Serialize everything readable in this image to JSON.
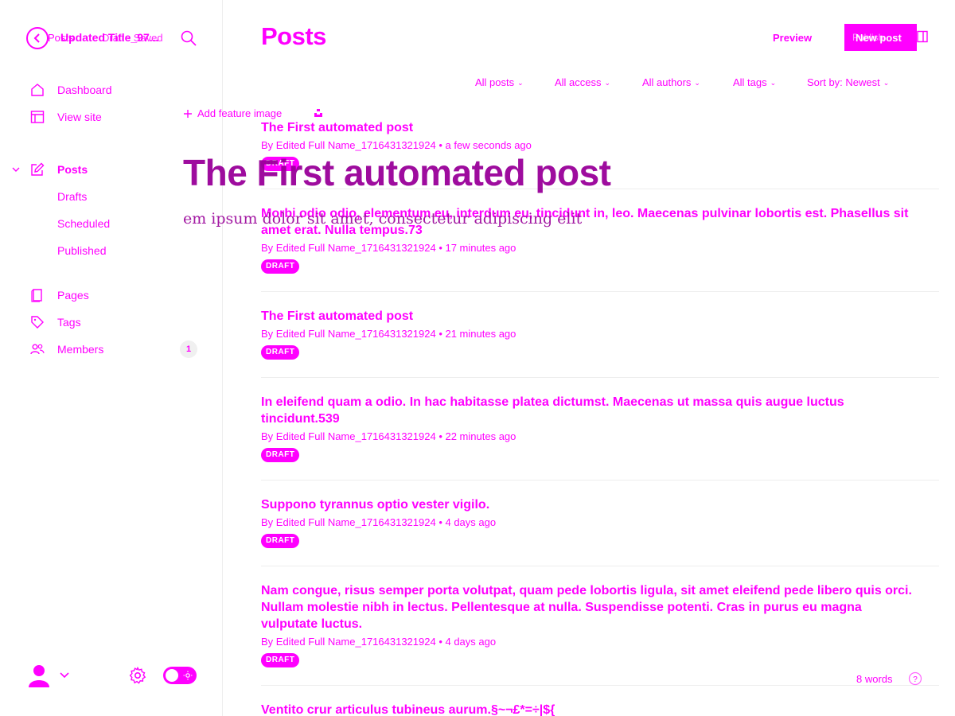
{
  "sidebar": {
    "nav": [
      {
        "label": "Dashboard"
      },
      {
        "label": "View site"
      },
      {
        "label": "Posts"
      },
      {
        "label": "Drafts"
      },
      {
        "label": "Scheduled"
      },
      {
        "label": "Published"
      },
      {
        "label": "Pages"
      },
      {
        "label": "Tags"
      },
      {
        "label": "Members",
        "badge": "1"
      }
    ]
  },
  "header": {
    "title": "Posts",
    "preview_label": "Preview",
    "new_post_label": "New post",
    "publish_label": "Publish"
  },
  "filters": [
    {
      "label": "All posts"
    },
    {
      "label": "All access"
    },
    {
      "label": "All authors"
    },
    {
      "label": "All tags"
    },
    {
      "label": "Sort by: Newest"
    }
  ],
  "posts": [
    {
      "title": "The First automated post",
      "meta": "By Edited Full Name_1716431321924 • a few seconds ago",
      "status": "DRAFT"
    },
    {
      "title": "Morbi odio odio, elementum eu, interdum eu, tincidunt in, leo. Maecenas pulvinar lobortis est. Phasellus sit amet erat. Nulla tempus.73",
      "meta": "By Edited Full Name_1716431321924 • 17 minutes ago",
      "status": "DRAFT"
    },
    {
      "title": "The First automated post",
      "meta": "By Edited Full Name_1716431321924 • 21 minutes ago",
      "status": "DRAFT"
    },
    {
      "title": "In eleifend quam a odio. In hac habitasse platea dictumst. Maecenas ut massa quis augue luctus tincidunt.539",
      "meta": "By Edited Full Name_1716431321924 • 22 minutes ago",
      "status": "DRAFT"
    },
    {
      "title": "Suppono tyrannus optio vester vigilo.",
      "meta": "By Edited Full Name_1716431321924 • 4 days ago",
      "status": "DRAFT"
    },
    {
      "title": "Nam congue, risus semper porta volutpat, quam pede lobortis ligula, sit amet eleifend pede libero quis orci. Nullam molestie nibh in lectus. Pellentesque at nulla. Suspendisse potenti. Cras in purus eu magna vulputate luctus.",
      "meta": "By Edited Full Name_1716431321924 • 4 days ago",
      "status": "DRAFT"
    },
    {
      "title": "Ventito crur articulus tubineus aurum.§~¬£*=÷|${",
      "meta": "",
      "status": ""
    }
  ],
  "editor_overlay": {
    "back_label": "Posts",
    "post_title_small": "Updated Title_97...",
    "save_state": "Draft - Saved",
    "add_feature_image": "Add feature image",
    "big_title": "The First automated post",
    "body_text": "em ipsum dolor sit amet, consectetur adipiscing elit",
    "word_count": "8 words"
  },
  "colors": {
    "accent": "#ff00ff",
    "overlay_title": "#990099",
    "divider": "#eeeeee",
    "badge_bg": "#f0f0f0"
  },
  "icons": {
    "back": "chevron-left-icon",
    "search": "search-icon",
    "dashboard": "home-icon",
    "view_site": "layout-icon",
    "posts": "pencil-square-icon",
    "pages": "page-icon",
    "tags": "tag-icon",
    "members": "users-icon",
    "avatar": "user-avatar-icon",
    "settings": "gear-icon",
    "theme_toggle": "sun-toggle-icon",
    "help": "help-circle-icon",
    "sidebar_toggle": "sidebar-panel-icon"
  }
}
